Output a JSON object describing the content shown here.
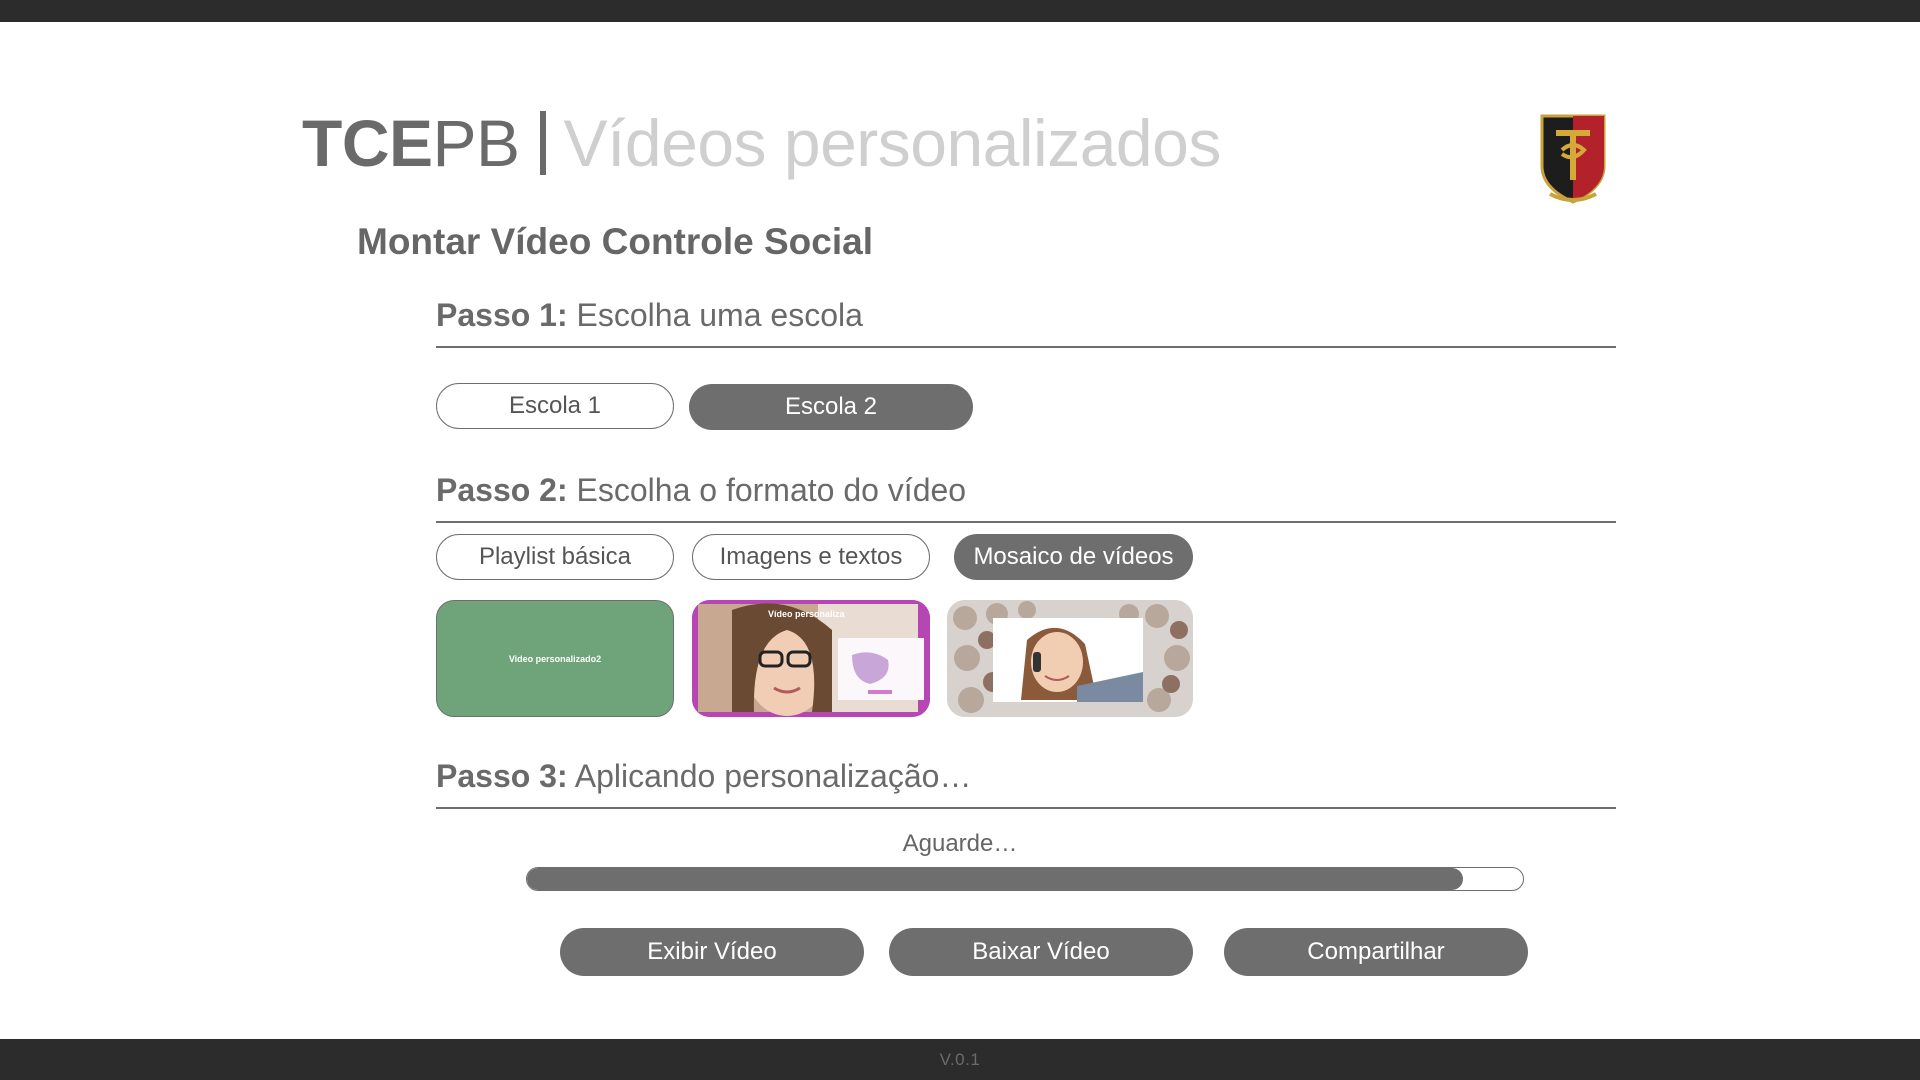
{
  "header": {
    "brand_bold": "TCE",
    "brand_light": "PB",
    "subtitle": "Vídeos personalizados"
  },
  "page_title": "Montar Vídeo Controle Social",
  "step1": {
    "label": "Passo 1:",
    "text": "Escolha uma escola",
    "options": [
      "Escola 1",
      "Escola 2"
    ],
    "selected": "Escola 2"
  },
  "step2": {
    "label": "Passo 2:",
    "text": "Escolha o formato do vídeo",
    "options": [
      "Playlist básica",
      "Imagens e textos",
      "Mosaico de vídeos"
    ],
    "selected": "Mosaico de vídeos",
    "thumb1_caption": "Video personalizado2",
    "thumb2_caption": "Vídeo personaliza"
  },
  "step3": {
    "label": "Passo 3:",
    "text": "Aplicando personalização…",
    "status": "Aguarde…",
    "progress_percent": 94
  },
  "actions": {
    "show": "Exibir Vídeo",
    "download": "Baixar Vídeo",
    "share": "Compartilhar"
  },
  "footer": {
    "version": "V.0.1"
  },
  "colors": {
    "accent_gray": "#6e6e6e",
    "bar_dark": "#2c2c2c",
    "thumb_green": "#6fa47a",
    "thumb_purple": "#b646b4"
  }
}
